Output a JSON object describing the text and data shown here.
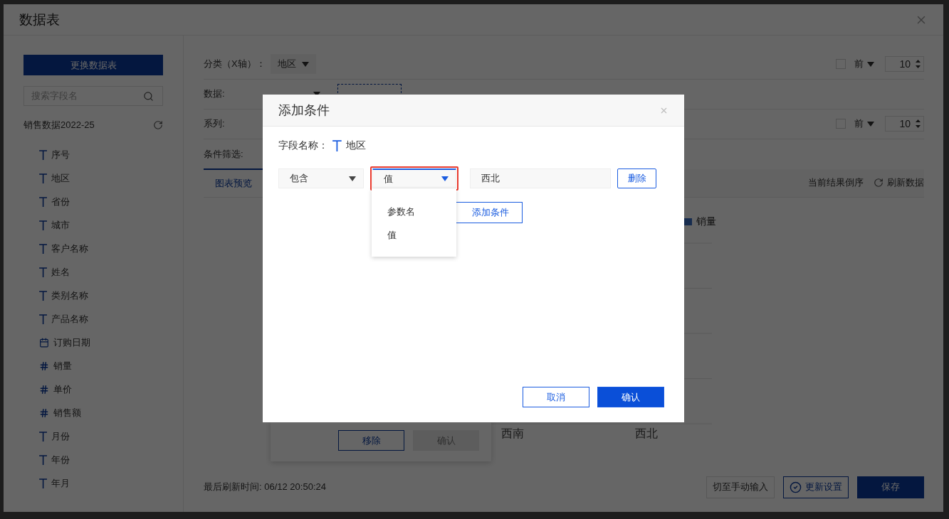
{
  "window": {
    "title": "数据表"
  },
  "sidebar": {
    "switch_button": "更换数据表",
    "search": {
      "placeholder": "搜索字段名"
    },
    "dataset": "销售数据2022-25",
    "fields": [
      {
        "kind": "text",
        "label": "序号"
      },
      {
        "kind": "text",
        "label": "地区"
      },
      {
        "kind": "text",
        "label": "省份"
      },
      {
        "kind": "text",
        "label": "城市"
      },
      {
        "kind": "text",
        "label": "客户名称"
      },
      {
        "kind": "text",
        "label": "姓名"
      },
      {
        "kind": "text",
        "label": "类别名称"
      },
      {
        "kind": "text",
        "label": "产品名称"
      },
      {
        "kind": "date",
        "label": "订购日期"
      },
      {
        "kind": "number",
        "label": "销量"
      },
      {
        "kind": "number",
        "label": "单价"
      },
      {
        "kind": "number",
        "label": "销售额"
      },
      {
        "kind": "text",
        "label": "月份"
      },
      {
        "kind": "text",
        "label": "年份"
      },
      {
        "kind": "text",
        "label": "年月"
      }
    ]
  },
  "config_rows": [
    {
      "kind": "category",
      "label": "分类（X轴）：",
      "value": "地区",
      "limit": {
        "checked": false,
        "order": "前",
        "count": "10"
      }
    },
    {
      "kind": "data",
      "label": "数据:"
    },
    {
      "kind": "series",
      "label": "系列:",
      "limit": {
        "checked": false,
        "order": "前",
        "count": "10"
      }
    },
    {
      "kind": "filter",
      "label": "条件筛选:"
    }
  ],
  "tabs": [
    {
      "label": "图表预览",
      "selected": true
    }
  ],
  "tab_tools": {
    "reverse": "当前结果倒序",
    "refresh": "刷新数据"
  },
  "chart": {
    "legend": "销量",
    "categories": [
      "西南",
      "西北"
    ]
  },
  "popover": {
    "buttons": [
      {
        "label": "移除",
        "disabled": false
      },
      {
        "label": "确认",
        "disabled": true
      }
    ]
  },
  "footer": {
    "last_refresh": "最后刷新时间: 06/12 20:50:24",
    "buttons": [
      {
        "kind": "plain",
        "label": "切至手动输入"
      },
      {
        "kind": "outline",
        "label": "更新设置"
      },
      {
        "kind": "primary",
        "label": "保存"
      }
    ]
  },
  "dialog": {
    "title": "添加条件",
    "field_label": "字段名称：",
    "field_name": "地区",
    "condition": {
      "operator": "包含",
      "source": "值",
      "source_highlighted": true,
      "value": "西北",
      "delete": "删除"
    },
    "source_menu": {
      "expanded": true,
      "options": [
        "参数名",
        "值"
      ]
    },
    "add_button": "添加条件",
    "cancel": "取消",
    "confirm": "确认"
  }
}
